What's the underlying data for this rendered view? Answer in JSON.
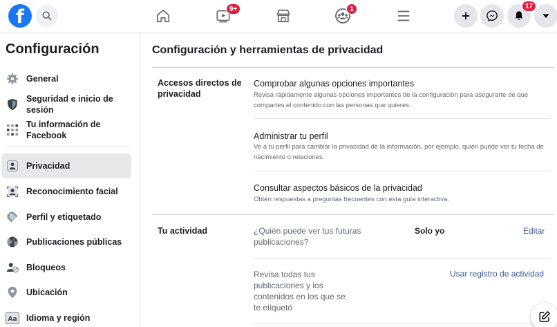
{
  "topbar": {
    "logo_letter": "f",
    "watch_badge": "9+",
    "groups_badge": "1",
    "notifications_badge": "17"
  },
  "sidebar": {
    "title": "Configuración",
    "items": [
      {
        "label": "General",
        "icon": "gear-icon"
      },
      {
        "label": "Seguridad e inicio de sesión",
        "icon": "shield-icon"
      },
      {
        "label": "Tu información de Facebook",
        "icon": "grid-icon"
      },
      {
        "label": "Privacidad",
        "icon": "lock-person-icon",
        "active": true
      },
      {
        "label": "Reconocimiento facial",
        "icon": "face-scan-icon"
      },
      {
        "label": "Perfil y etiquetado",
        "icon": "tag-icon"
      },
      {
        "label": "Publicaciones públicas",
        "icon": "globe-icon"
      },
      {
        "label": "Bloqueos",
        "icon": "block-user-icon"
      },
      {
        "label": "Ubicación",
        "icon": "location-pin-icon"
      },
      {
        "label": "Idioma y región",
        "icon": "language-icon"
      }
    ]
  },
  "main": {
    "title": "Configuración y herramientas de privacidad",
    "shortcuts": {
      "label": "Accesos directos de privacidad",
      "rows": [
        {
          "title": "Comprobar algunas opciones importantes",
          "desc": "Revisa rápidamente algunas opciones importantes de la configuración para asegurarte de que compartes el contenido con las personas que quieres."
        },
        {
          "title": "Administrar tu perfil",
          "desc": "Ve a tu perfil para cambiar la privacidad de la información, por ejemplo, quién puede ver tu fecha de nacimiento o relaciones."
        },
        {
          "title": "Consultar aspectos básicos de la privacidad",
          "desc": "Obtén respuestas a preguntas frecuentes con esta guía interactiva."
        }
      ]
    },
    "activity": {
      "label": "Tu actividad",
      "future_posts_question": "¿Quién puede ver tus futuras publicaciones?",
      "future_posts_value": "Solo yo",
      "edit_link": "Editar",
      "review_text": "Revisa todas tus publicaciones y los contenidos en los que se te etiquetó",
      "activity_log_link": "Usar registro de actividad"
    }
  },
  "colors": {
    "brand": "#1877f2",
    "badge": "#e41e3f",
    "link": "#385898"
  }
}
